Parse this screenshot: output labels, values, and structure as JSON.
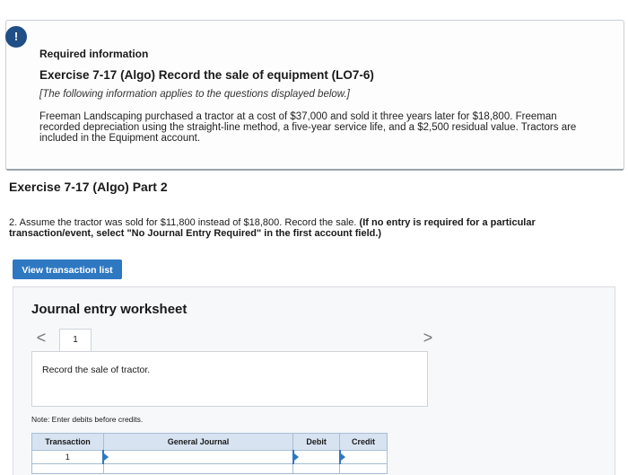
{
  "info": {
    "badge": "!",
    "label": "Required information",
    "title": "Exercise 7-17 (Algo) Record the sale of equipment (LO7-6)",
    "note": "[The following information applies to the questions displayed below.]",
    "body": "Freeman Landscaping purchased a tractor at a cost of $37,000 and sold it three years later for $18,800. Freeman recorded depreciation using the straight-line method, a five-year service life, and a $2,500 residual value. Tractors are included in the Equipment account."
  },
  "part": {
    "title": "Exercise 7-17 (Algo) Part 2",
    "question": "2. Assume the tractor was sold for $11,800 instead of $18,800. Record the sale.",
    "instruction": "(If no entry is required for a particular transaction/event, select \"No Journal Entry Required\" in the first account field.)"
  },
  "buttons": {
    "view_transaction_list": "View transaction list"
  },
  "worksheet": {
    "title": "Journal entry worksheet",
    "prev_icon": "<",
    "next_icon": ">",
    "current_tab": "1",
    "entry_description": "Record the sale of tractor.",
    "note": "Note: Enter debits before credits.",
    "table": {
      "headers": [
        "Transaction",
        "General Journal",
        "Debit",
        "Credit"
      ],
      "rows": [
        {
          "transaction": "1",
          "account": "",
          "debit": "",
          "credit": ""
        },
        {
          "transaction": "",
          "account": "",
          "debit": "",
          "credit": ""
        }
      ]
    }
  },
  "colors": {
    "accent": "#2e78c2",
    "badge": "#1f4f86",
    "table_header": "#d7e3f1"
  }
}
